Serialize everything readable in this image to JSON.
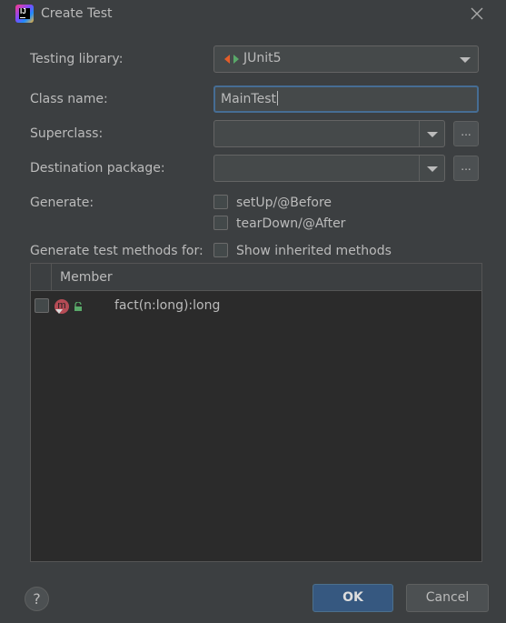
{
  "window": {
    "title": "Create Test",
    "app_icon_text": "IJ"
  },
  "form": {
    "testing_library": {
      "label": "Testing library:",
      "value": "JUnit5"
    },
    "class_name": {
      "label": "Class name:",
      "value": "MainTest"
    },
    "superclass": {
      "label": "Superclass:",
      "value": "",
      "browse_label": "..."
    },
    "destination_package": {
      "label": "Destination package:",
      "value": "",
      "browse_label": "..."
    },
    "generate": {
      "label": "Generate:",
      "setup": {
        "label": "setUp/@Before",
        "checked": false
      },
      "teardown": {
        "label": "tearDown/@After",
        "checked": false
      }
    },
    "methods_for": {
      "label": "Generate test methods for:",
      "show_inherited": {
        "label": "Show inherited methods",
        "checked": false
      }
    }
  },
  "members_table": {
    "header": "Member",
    "rows": [
      {
        "icon": "m",
        "name": "fact(n:long):long",
        "checked": false
      }
    ]
  },
  "buttons": {
    "help": "?",
    "ok": "OK",
    "cancel": "Cancel"
  },
  "colors": {
    "background": "#3c3f41",
    "field": "#45494a",
    "focus_border": "#466d94",
    "primary_button": "#365880",
    "method_icon": "#b54b55",
    "junit_left": "#e35d2a",
    "junit_right": "#59a869"
  }
}
